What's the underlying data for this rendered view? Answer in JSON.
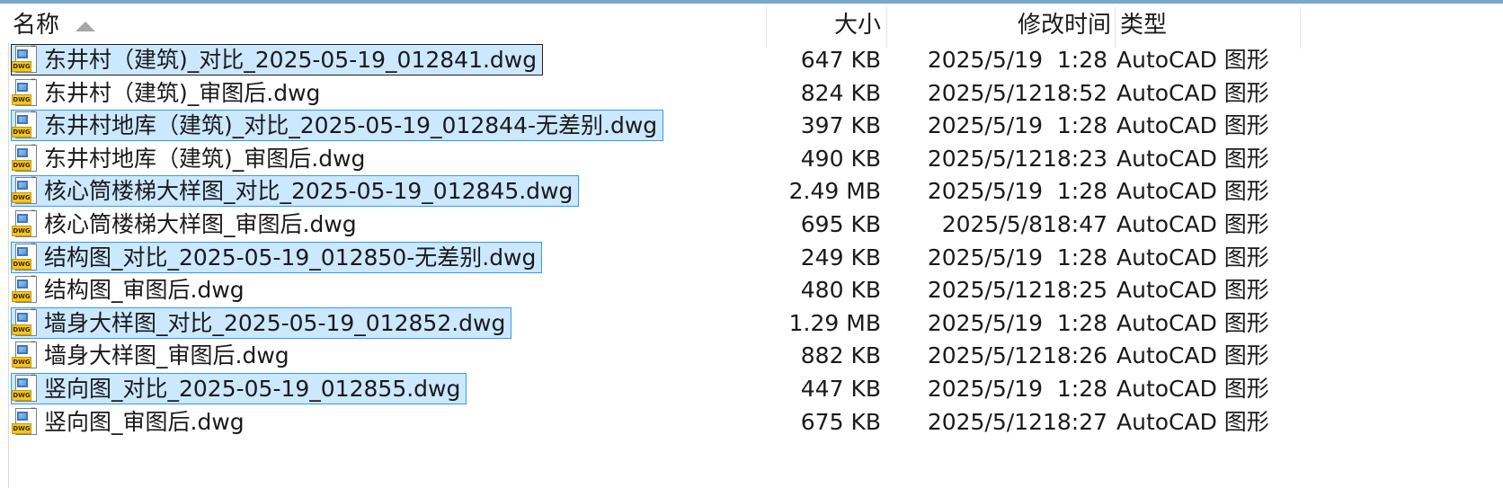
{
  "columns": {
    "name": "名称",
    "size": "大小",
    "modified": "修改时间",
    "type": "类型"
  },
  "icon": {
    "name": "dwg-file-icon",
    "tag": "DWG",
    "tm": "™"
  },
  "files": [
    {
      "name": "东井村（建筑)_对比_2025-05-19_012841.dwg",
      "size": "647 KB",
      "date": "2025/5/19",
      "time": "1:28",
      "type": "AutoCAD 图形",
      "selected": true,
      "focused": true
    },
    {
      "name": "东井村（建筑)_审图后.dwg",
      "size": "824 KB",
      "date": "2025/5/12",
      "time": "18:52",
      "type": "AutoCAD 图形",
      "selected": false
    },
    {
      "name": "东井村地库（建筑)_对比_2025-05-19_012844-无差别.dwg",
      "size": "397 KB",
      "date": "2025/5/19",
      "time": "1:28",
      "type": "AutoCAD 图形",
      "selected": true
    },
    {
      "name": "东井村地库（建筑)_审图后.dwg",
      "size": "490 KB",
      "date": "2025/5/12",
      "time": "18:23",
      "type": "AutoCAD 图形",
      "selected": false
    },
    {
      "name": "核心筒楼梯大样图_对比_2025-05-19_012845.dwg",
      "size": "2.49 MB",
      "date": "2025/5/19",
      "time": "1:28",
      "type": "AutoCAD 图形",
      "selected": true
    },
    {
      "name": "核心筒楼梯大样图_审图后.dwg",
      "size": "695 KB",
      "date": "2025/5/8",
      "time": "18:47",
      "type": "AutoCAD 图形",
      "selected": false
    },
    {
      "name": "结构图_对比_2025-05-19_012850-无差别.dwg",
      "size": "249 KB",
      "date": "2025/5/19",
      "time": "1:28",
      "type": "AutoCAD 图形",
      "selected": true
    },
    {
      "name": "结构图_审图后.dwg",
      "size": "480 KB",
      "date": "2025/5/12",
      "time": "18:25",
      "type": "AutoCAD 图形",
      "selected": false
    },
    {
      "name": "墙身大样图_对比_2025-05-19_012852.dwg",
      "size": "1.29 MB",
      "date": "2025/5/19",
      "time": "1:28",
      "type": "AutoCAD 图形",
      "selected": true
    },
    {
      "name": "墙身大样图_审图后.dwg",
      "size": "882 KB",
      "date": "2025/5/12",
      "time": "18:26",
      "type": "AutoCAD 图形",
      "selected": false
    },
    {
      "name": "竖向图_对比_2025-05-19_012855.dwg",
      "size": "447 KB",
      "date": "2025/5/19",
      "time": "1:28",
      "type": "AutoCAD 图形",
      "selected": true
    },
    {
      "name": "竖向图_审图后.dwg",
      "size": "675 KB",
      "date": "2025/5/12",
      "time": "18:27",
      "type": "AutoCAD 图形",
      "selected": false
    }
  ]
}
